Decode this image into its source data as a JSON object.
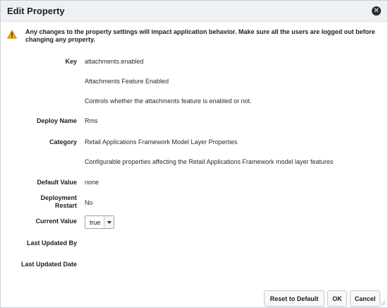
{
  "dialog": {
    "title": "Edit Property",
    "close_icon": "close-icon"
  },
  "warning": {
    "icon": "warning-icon",
    "text": "Any changes to the property settings will impact application behavior. Make sure all the users are logged out before changing any property."
  },
  "fields": {
    "key": {
      "label": "Key",
      "value": "attachments.enabled",
      "name": "Attachments Feature Enabled",
      "description": "Controls whether the attachments feature is enabled or not."
    },
    "deploy_name": {
      "label": "Deploy Name",
      "value": "Rms"
    },
    "category": {
      "label": "Category",
      "value": "Retail Applications Framework Model Layer Properties",
      "description": "Configurable properties affecting the Retail Applications Framework model layer features"
    },
    "default_value": {
      "label": "Default Value",
      "value": "none"
    },
    "deployment_restart": {
      "label": "Deployment Restart",
      "value": "No"
    },
    "current_value": {
      "label": "Current Value",
      "value": "true"
    },
    "last_updated_by": {
      "label": "Last Updated By",
      "value": ""
    },
    "last_updated_date": {
      "label": "Last Updated Date",
      "value": ""
    }
  },
  "buttons": {
    "reset": "Reset to Default",
    "ok": "OK",
    "cancel": "Cancel"
  },
  "colors": {
    "warning_icon": "#e8a800",
    "titlebar_bg": "#eef1f4"
  }
}
